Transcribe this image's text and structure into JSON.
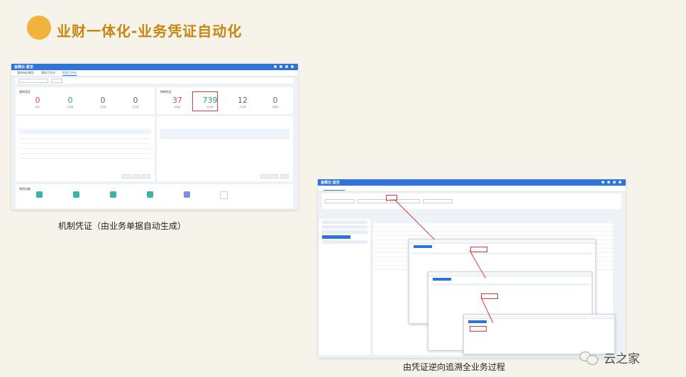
{
  "slide": {
    "title": "业财一体化-业务凭证自动化",
    "caption_left": "机制凭证（由业务单据自动生成）",
    "caption_right": "由凭证逆向追溯全业务过程",
    "watermark": "云之家",
    "accent_color": "#f0b43c",
    "title_color": "#c9860f"
  },
  "dashboard": {
    "app_name": "金蝶云·星空",
    "tabs": [
      "我的待办事项",
      "我的工作台",
      "财务工作台"
    ],
    "left_card": {
      "title": "我的凭证",
      "stats": [
        {
          "value": "0",
          "label": "暂存",
          "color": "#e34b4b"
        },
        {
          "value": "0",
          "label": "已审核",
          "color": "#2aa86b"
        },
        {
          "value": "0",
          "label": "已过账",
          "color": "#666666"
        },
        {
          "value": "0",
          "label": "已记账",
          "color": "#666666"
        }
      ]
    },
    "right_card": {
      "title": "待审凭证",
      "stats": [
        {
          "value": "37",
          "label": "未审核",
          "color": "#e34b4b"
        },
        {
          "value": "739",
          "label": "未过账",
          "color": "#2aa86b"
        },
        {
          "value": "12",
          "label": "已记账",
          "color": "#666666"
        },
        {
          "value": "0",
          "label": "待审核",
          "color": "#666666"
        }
      ]
    },
    "bottom_title": "常用功能"
  },
  "trace": {
    "app_name": "金蝶云·星空"
  }
}
